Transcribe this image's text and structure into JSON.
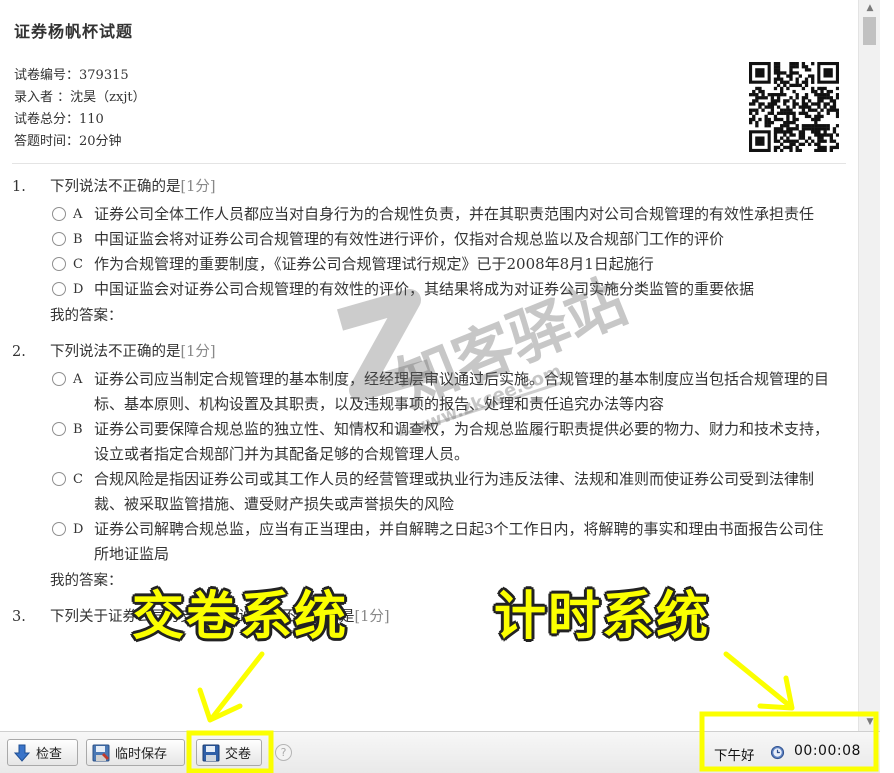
{
  "paper": {
    "title": "证券杨帆杯试题",
    "meta": [
      {
        "label": "试卷编号：",
        "value": "379315"
      },
      {
        "label": "录入者  ：",
        "value": "沈昊（zxjt）"
      },
      {
        "label": "试卷总分：",
        "value": "110"
      },
      {
        "label": "答题时间：",
        "value": "20分钟"
      }
    ]
  },
  "questions": [
    {
      "num": "1.",
      "text": "下列说法不正确的是",
      "score": "[1分]",
      "options": [
        {
          "letter": "A",
          "text": "证券公司全体工作人员都应当对自身行为的合规性负责，并在其职责范围内对公司合规管理的有效性承担责任"
        },
        {
          "letter": "B",
          "text": "中国证监会将对证券公司合规管理的有效性进行评价，仅指对合规总监以及合规部门工作的评价"
        },
        {
          "letter": "C",
          "text": "作为合规管理的重要制度，《证券公司合规管理试行规定》已于2008年8月1日起施行"
        },
        {
          "letter": "D",
          "text": "中国证监会对证券公司合规管理的有效性的评价，其结果将成为对证券公司实施分类监管的重要依据"
        }
      ],
      "answer_label": "我的答案："
    },
    {
      "num": "2.",
      "text": "下列说法不正确的是",
      "score": "[1分]",
      "options": [
        {
          "letter": "A",
          "text": "证券公司应当制定合规管理的基本制度，经经理层审议通过后实施。合规管理的基本制度应当包括合规管理的目标、基本原则、机构设置及其职责，以及违规事项的报告、处理和责任追究办法等内容"
        },
        {
          "letter": "B",
          "text": "证券公司要保障合规总监的独立性、知情权和调查权，为合规总监履行职责提供必要的物力、财力和技术支持，设立或者指定合规部门并为其配备足够的合规管理人员。"
        },
        {
          "letter": "C",
          "text": "合规风险是指因证券公司或其工作人员的经营管理或执业行为违反法律、法规和准则而使证券公司受到法律制裁、被采取监管措施、遭受财产损失或声誉损失的风险"
        },
        {
          "letter": "D",
          "text": "证券公司解聘合规总监，应当有正当理由，并自解聘之日起3个工作日内，将解聘的事实和理由书面报告公司住所地证监局"
        }
      ],
      "answer_label": "我的答案："
    },
    {
      "num": "3.",
      "text": "下列关于证券公司分支机构的说法，不正确的是",
      "score": "[1分]",
      "options": [],
      "answer_label": ""
    }
  ],
  "watermark": {
    "brand": "知客驿站",
    "url": "www.zkcee.com"
  },
  "annotations": {
    "submit_callout": "交卷系统",
    "timer_callout": "计时系统",
    "color": "#fbff00"
  },
  "toolbar": {
    "check_label": "检查",
    "save_label": "临时保存",
    "submit_label": "交卷",
    "help_glyph": "?",
    "greeting": "下午好",
    "timer": "00:00:08"
  }
}
